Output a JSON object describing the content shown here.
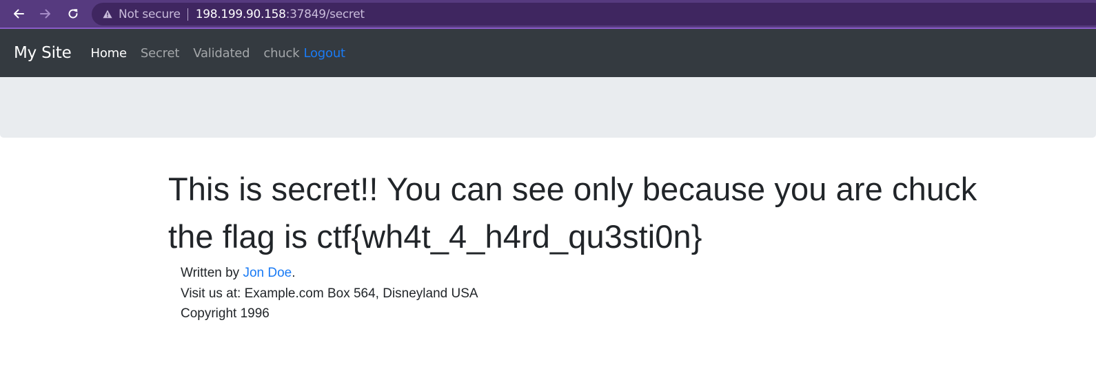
{
  "browser": {
    "security_label": "Not secure",
    "url_host": "198.199.90.158",
    "url_rest": ":37849/secret",
    "icons": {
      "back": "back-arrow-icon",
      "forward": "forward-arrow-icon",
      "reload": "reload-icon",
      "warning": "warning-triangle-icon"
    },
    "colors": {
      "toolbar": "#563a7f",
      "omnibox": "#3f2660"
    }
  },
  "navbar": {
    "brand": "My Site",
    "links": [
      {
        "label": "Home",
        "active": true
      },
      {
        "label": "Secret",
        "active": false
      },
      {
        "label": "Validated",
        "active": false
      }
    ],
    "user": "chuck",
    "logout": "Logout",
    "colors": {
      "background": "#343a40",
      "link_accent": "#1a7bf5"
    }
  },
  "main": {
    "headline_line1": "This is secret!! You can see only because you are chuck",
    "headline_line2": "the flag is ctf{wh4t_4_h4rd_qu3sti0n}"
  },
  "footer": {
    "written_by_prefix": "Written by ",
    "author": "Jon Doe",
    "written_by_suffix": ".",
    "address": "Visit us at: Example.com Box 564, Disneyland USA",
    "copyright": "Copyright 1996"
  }
}
